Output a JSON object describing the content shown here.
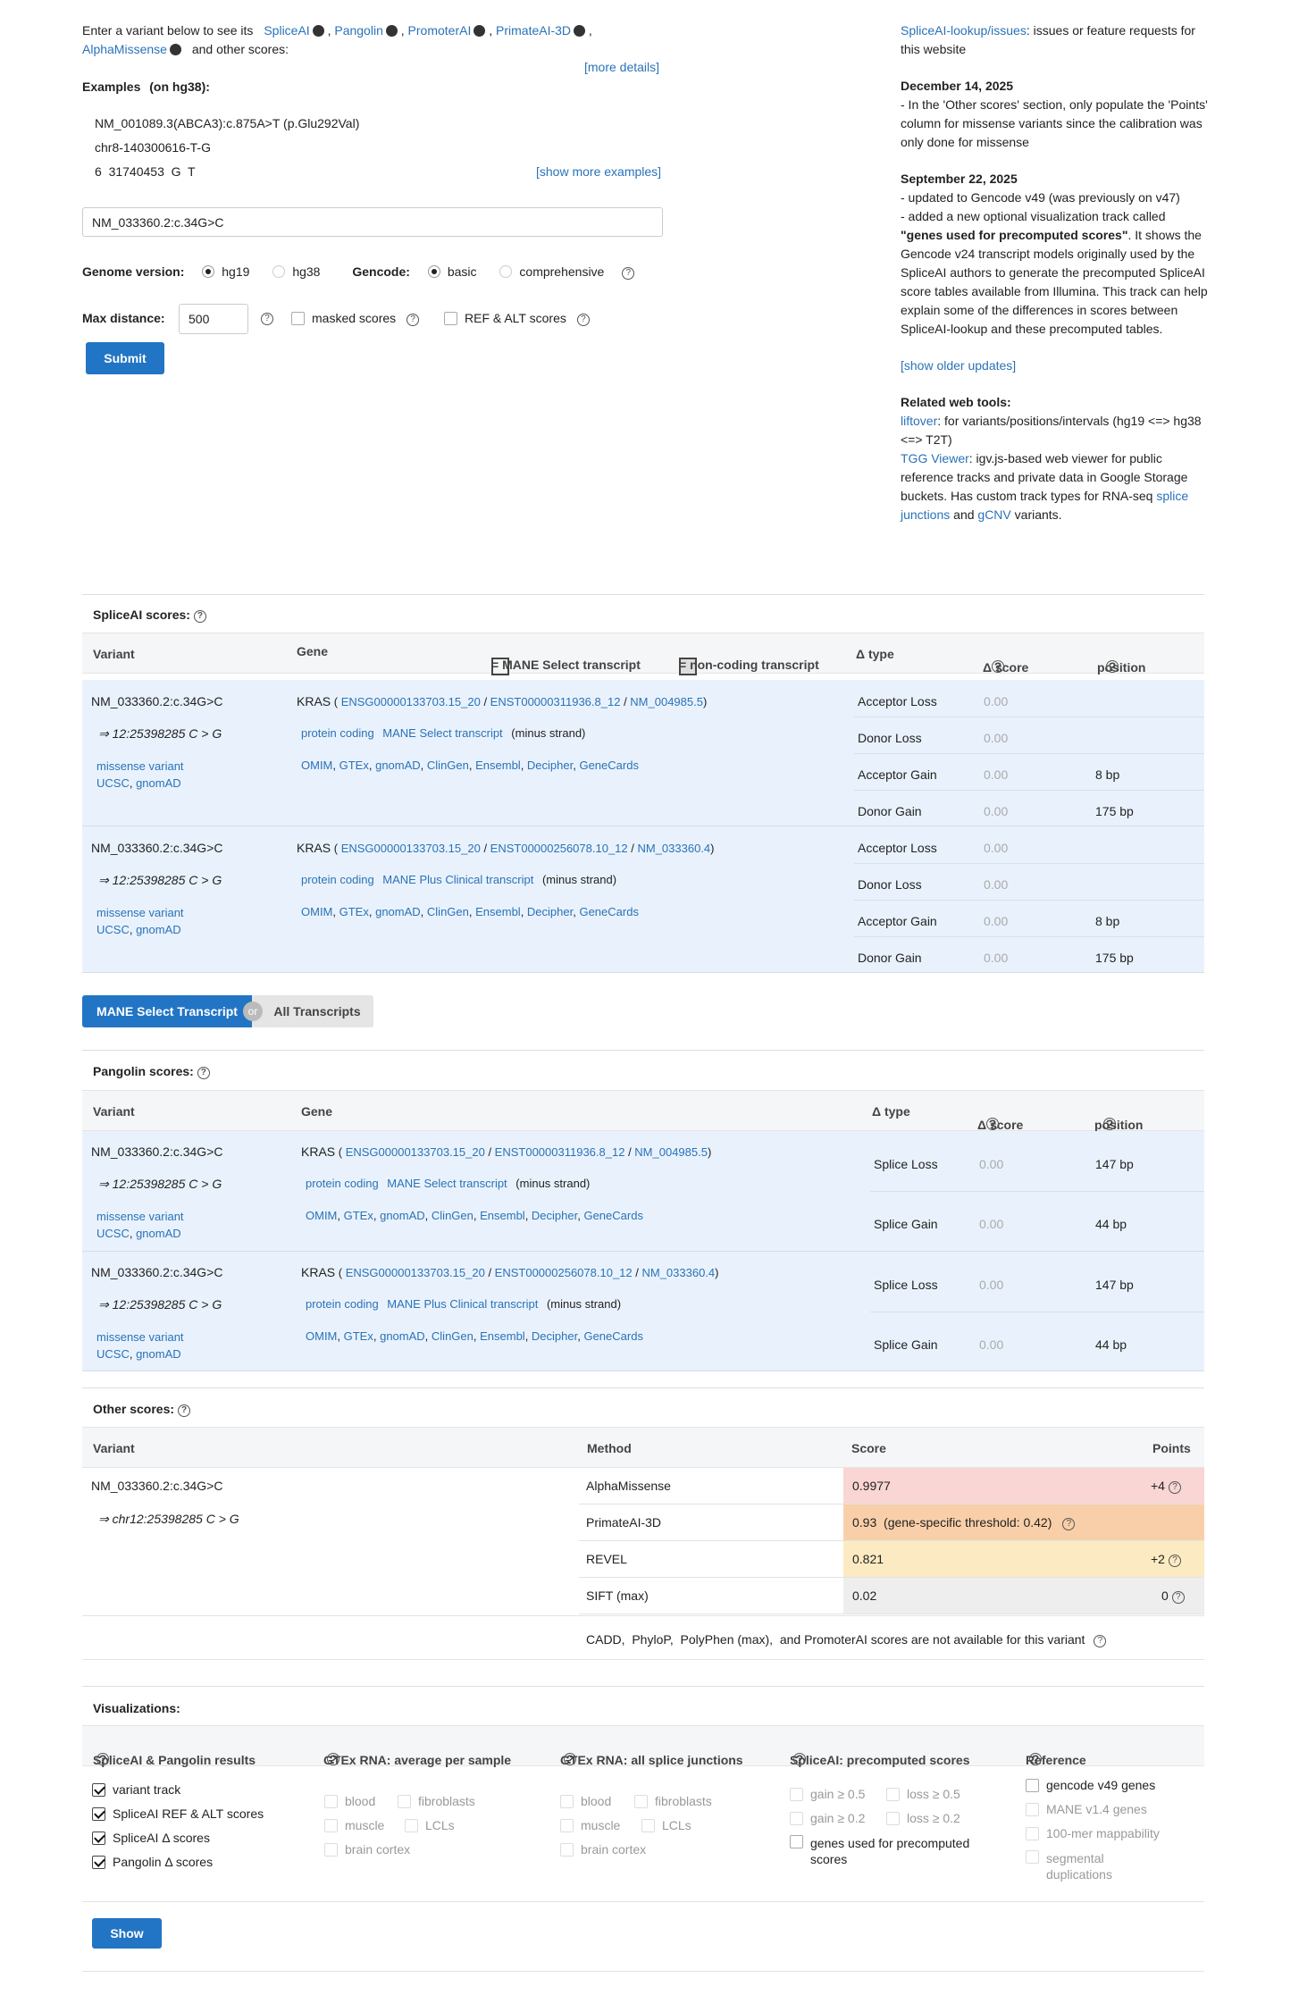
{
  "intro": {
    "text1": "Enter a variant below to see its",
    "tools": [
      "SpliceAI",
      "Pangolin",
      "PromoterAI",
      "PrimateAI-3D",
      "AlphaMissense"
    ],
    "text2": "and other scores:",
    "more_details": "[more details]"
  },
  "examples": {
    "title": "Examples",
    "sub": "(on hg38):",
    "items": [
      "NM_001089.3(ABCA3):c.875A>T (p.Glu292Val)",
      "chr8-140300616-T-G",
      "6  31740453  G  T"
    ],
    "show_more": "[show more examples]"
  },
  "input": {
    "value": "NM_033360.2:c.34G>C"
  },
  "genome": {
    "label": "Genome version:",
    "options": [
      "hg19",
      "hg38"
    ],
    "selected": "hg19"
  },
  "gencode": {
    "label": "Gencode:",
    "options": [
      "basic",
      "comprehensive"
    ],
    "selected": "basic"
  },
  "maxdist": {
    "label": "Max distance:",
    "value": "500",
    "masked": "masked scores",
    "refalt": "REF & ALT scores"
  },
  "submit": "Submit",
  "news": {
    "issues_link": "SpliceAI-lookup/issues",
    "issues_text": ": issues or feature requests for this website",
    "d1": "December 14, 2025",
    "d1_text": "- In the 'Other scores' section, only populate the 'Points' column for missense variants since the calibration was only done for missense",
    "d2": "September 22, 2025",
    "d2_l1": "- updated to Gencode v49 (was previously on v47)",
    "d2_l2": "- added a new optional visualization track called",
    "d2_bold": "\"genes used for precomputed scores\"",
    "d2_rest": ". It shows the Gencode v24 transcript models originally used by the SpliceAI authors to generate the precomputed SpliceAI score tables available from Illumina. This track can help explain some of the differences in scores between SpliceAI-lookup and these precomputed tables.",
    "older": "[show older updates]",
    "related": "Related web tools:",
    "liftover": "liftover",
    "liftover_text": ": for variants/positions/intervals (hg19 <=> hg38 <=> T2T)",
    "tgg": "TGG Viewer",
    "tgg_text": ": igv.js-based web viewer for public reference tracks and private data in Google Storage buckets. Has custom track types for RNA-seq",
    "splice": "splice junctions",
    "and": "and",
    "gcnv": "gCNV",
    "variants": "variants."
  },
  "spliceai": {
    "title": "SpliceAI scores:",
    "headers": {
      "variant": "Variant",
      "gene": "Gene",
      "mane": "= MANE Select transcript",
      "noncoding": "= non-coding transcript",
      "dtype": "Δ type",
      "dscore": "Δ score",
      "position": "position"
    },
    "rows": [
      {
        "variant": "NM_033360.2:c.34G>C",
        "pos": "⇒ 12:25398285 C > G",
        "conseq": "missense variant",
        "ucsc": "UCSC",
        "gnomad": "gnomAD",
        "gene": "KRAS",
        "ensg": "ENSG00000133703.15_20",
        "enst": "ENST00000311936.8_12",
        "nm": "NM_004985.5",
        "biotype": "protein coding",
        "tag": "MANE Select transcript",
        "strand": "(minus strand)",
        "scores": [
          {
            "t": "Acceptor Loss",
            "s": "0.00",
            "p": ""
          },
          {
            "t": "Donor Loss",
            "s": "0.00",
            "p": ""
          },
          {
            "t": "Acceptor Gain",
            "s": "0.00",
            "p": "8 bp"
          },
          {
            "t": "Donor Gain",
            "s": "0.00",
            "p": "175 bp"
          }
        ]
      },
      {
        "variant": "NM_033360.2:c.34G>C",
        "pos": "⇒ 12:25398285 C > G",
        "conseq": "missense variant",
        "ucsc": "UCSC",
        "gnomad": "gnomAD",
        "gene": "KRAS",
        "ensg": "ENSG00000133703.15_20",
        "enst": "ENST00000256078.10_12",
        "nm": "NM_033360.4",
        "biotype": "protein coding",
        "tag": "MANE Plus Clinical transcript",
        "strand": "(minus strand)",
        "scores": [
          {
            "t": "Acceptor Loss",
            "s": "0.00",
            "p": ""
          },
          {
            "t": "Donor Loss",
            "s": "0.00",
            "p": ""
          },
          {
            "t": "Acceptor Gain",
            "s": "0.00",
            "p": "8 bp"
          },
          {
            "t": "Donor Gain",
            "s": "0.00",
            "p": "175 bp"
          }
        ]
      }
    ],
    "links": [
      "OMIM",
      "GTEx",
      "gnomAD",
      "ClinGen",
      "Ensembl",
      "Decipher",
      "GeneCards"
    ]
  },
  "toggle": {
    "mane": "MANE Select Transcript",
    "or": "or",
    "all": "All Transcripts"
  },
  "pangolin": {
    "title": "Pangolin scores:",
    "headers": {
      "variant": "Variant",
      "gene": "Gene",
      "dtype": "Δ type",
      "dscore": "Δ score",
      "position": "position"
    },
    "rows": [
      {
        "variant": "NM_033360.2:c.34G>C",
        "pos": "⇒ 12:25398285 C > G",
        "conseq": "missense variant",
        "ucsc": "UCSC",
        "gnomad": "gnomAD",
        "gene": "KRAS",
        "ensg": "ENSG00000133703.15_20",
        "enst": "ENST00000311936.8_12",
        "nm": "NM_004985.5",
        "biotype": "protein coding",
        "tag": "MANE Select transcript",
        "strand": "(minus strand)",
        "scores": [
          {
            "t": "Splice Loss",
            "s": "0.00",
            "p": "147 bp"
          },
          {
            "t": "Splice Gain",
            "s": "0.00",
            "p": "44 bp"
          }
        ]
      },
      {
        "variant": "NM_033360.2:c.34G>C",
        "pos": "⇒ 12:25398285 C > G",
        "conseq": "missense variant",
        "ucsc": "UCSC",
        "gnomad": "gnomAD",
        "gene": "KRAS",
        "ensg": "ENSG00000133703.15_20",
        "enst": "ENST00000256078.10_12",
        "nm": "NM_033360.4",
        "biotype": "protein coding",
        "tag": "MANE Plus Clinical transcript",
        "strand": "(minus strand)",
        "scores": [
          {
            "t": "Splice Loss",
            "s": "0.00",
            "p": "147 bp"
          },
          {
            "t": "Splice Gain",
            "s": "0.00",
            "p": "44 bp"
          }
        ]
      }
    ]
  },
  "other": {
    "title": "Other scores:",
    "headers": {
      "variant": "Variant",
      "method": "Method",
      "score": "Score",
      "points": "Points"
    },
    "variant": "NM_033360.2:c.34G>C",
    "pos": "⇒ chr12:25398285 C > G",
    "rows": [
      {
        "m": "AlphaMissense",
        "s": "0.9977",
        "p": "+4",
        "color": "#f9d6d3"
      },
      {
        "m": "PrimateAI-3D",
        "s": "0.93  (gene-specific threshold: 0.42)",
        "p": "",
        "color": "#f9cfa9"
      },
      {
        "m": "REVEL",
        "s": "0.821",
        "p": "+2",
        "color": "#fcebc2"
      },
      {
        "m": "SIFT (max)",
        "s": "0.02",
        "p": "0",
        "color": "#eeeeee"
      }
    ],
    "na": "CADD,  PhyloP,  PolyPhen (max),  and PromoterAI scores are not available for this variant"
  },
  "viz": {
    "title": "Visualizations:",
    "cols": [
      "SpliceAI & Pangolin results",
      "GTEx RNA: average per sample",
      "GTEx RNA: all splice junctions",
      "SpliceAI: precomputed scores",
      "Reference"
    ],
    "col1": [
      "variant track",
      "SpliceAI REF & ALT scores",
      "SpliceAI Δ  scores",
      "Pangolin Δ  scores"
    ],
    "tissues": [
      "blood",
      "fibroblasts",
      "muscle",
      "LCLs",
      "brain cortex"
    ],
    "pre": [
      "gain ≥ 0.5",
      "loss ≥ 0.5",
      "gain ≥ 0.2",
      "loss ≥ 0.2",
      "genes used for precomputed scores"
    ],
    "ref": [
      "gencode v49 genes",
      "MANE v1.4 genes",
      "100-mer mappability",
      "segmental duplications"
    ],
    "show": "Show"
  },
  "colors": {
    "accent": "#2275c4",
    "link": "#2a72b8",
    "panel": "#e9f2fc"
  }
}
